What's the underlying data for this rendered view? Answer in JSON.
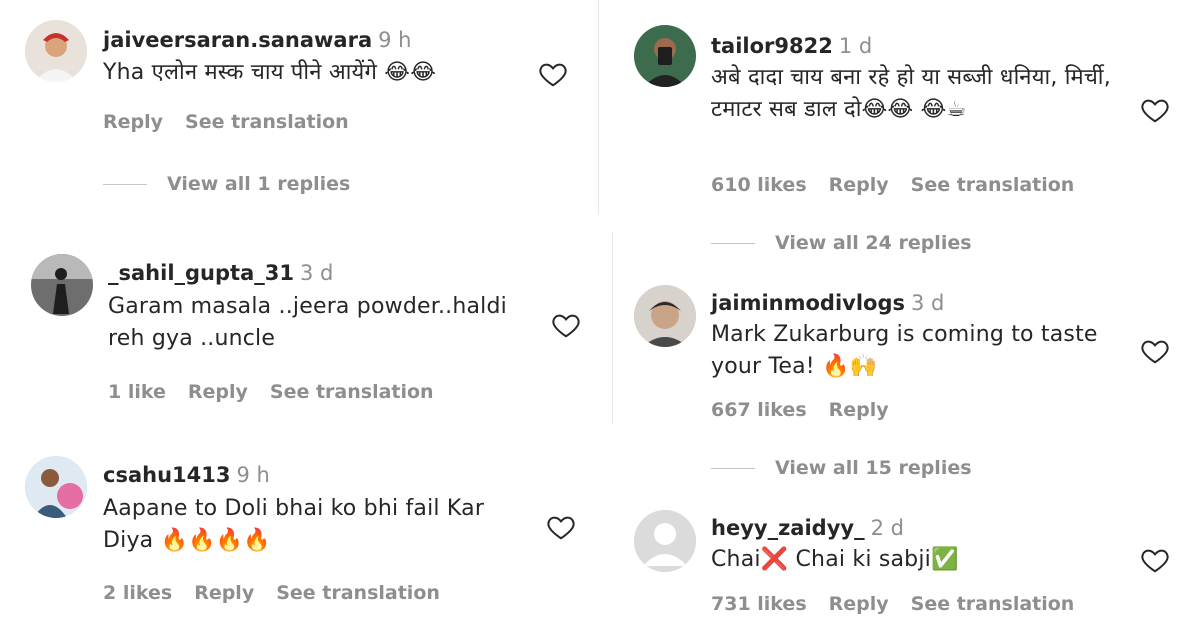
{
  "left": [
    {
      "user": "jaiveersaran.sanawara",
      "time": "9 h",
      "text": "Yha एलोन मस्क चाय पीने आयेंगे 😂😂",
      "likes": "",
      "reply": "Reply",
      "translate": "See translation",
      "view_replies": "View all 1 replies",
      "avatar_colors": [
        "#c9302c",
        "#f1e4d8"
      ]
    },
    {
      "user": "_sahil_gupta_31",
      "time": "3 d",
      "text": "Garam masala ..jeera powder..haldi reh gya ..uncle",
      "likes": "1 like",
      "reply": "Reply",
      "translate": "See translation",
      "view_replies": "",
      "avatar_colors": [
        "#3a3a3a",
        "#9a9a9a"
      ]
    },
    {
      "user": "csahu1413",
      "time": "9 h",
      "text": "Aapane to Doli bhai ko bhi fail Kar Diya 🔥🔥🔥🔥",
      "likes": "2 likes",
      "reply": "Reply",
      "translate": "See translation",
      "view_replies": "",
      "avatar_colors": [
        "#e46ea4",
        "#3b5b7a"
      ]
    }
  ],
  "right": [
    {
      "user": "tailor9822",
      "time": "1 d",
      "text": "अबे दादा चाय बना रहे हो या सब्जी धनिया, मिर्ची, टमाटर सब डाल दो😂😂 😂☕",
      "likes": "610 likes",
      "reply": "Reply",
      "translate": "See translation",
      "view_replies": "View all 24 replies",
      "avatar_colors": [
        "#3d6b4e",
        "#1e1e1e"
      ]
    },
    {
      "user": "jaiminmodivlogs",
      "time": "3 d",
      "text": "Mark Zukarburg is coming to taste your Tea! 🔥🙌",
      "likes": "667 likes",
      "reply": "Reply",
      "translate": "",
      "view_replies": "View all 15 replies",
      "avatar_colors": [
        "#4a4a4a",
        "#c9b8a6"
      ]
    },
    {
      "user": "heyy_zaidyy_",
      "time": "2 d",
      "text": "Chai❌ Chai ki sabji✅",
      "likes": "731 likes",
      "reply": "Reply",
      "translate": "See translation",
      "view_replies": "",
      "avatar_colors": [
        "#dbdbdb",
        "#ffffff"
      ]
    }
  ]
}
